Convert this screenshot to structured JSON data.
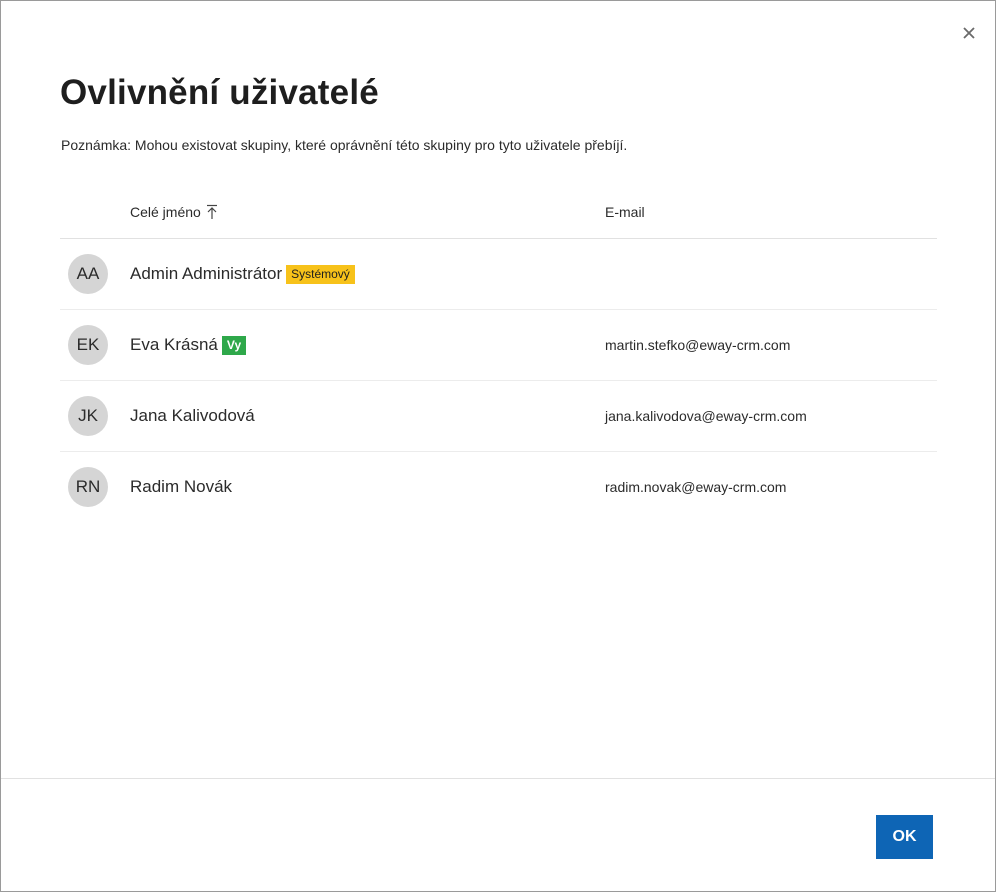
{
  "dialog": {
    "title": "Ovlivnění uživatelé",
    "note": "Poznámka: Mohou existovat skupiny, které oprávnění této skupiny pro tyto uživatele přebíjí.",
    "close_icon": "close-icon"
  },
  "table": {
    "columns": {
      "name": "Celé jméno",
      "email": "E-mail"
    },
    "sort_icon": "sort-ascending-icon",
    "rows": [
      {
        "initials": "AA",
        "name": "Admin Administrátor",
        "badge": "Systémový",
        "email": ""
      },
      {
        "initials": "EK",
        "name": "Eva Krásná",
        "badge": "Vy",
        "email": "martin.stefko@eway-crm.com"
      },
      {
        "initials": "JK",
        "name": "Jana Kalivodová",
        "badge": "",
        "email": "jana.kalivodova@eway-crm.com"
      },
      {
        "initials": "RN",
        "name": "Radim Novák",
        "badge": "",
        "email": "radim.novak@eway-crm.com"
      }
    ]
  },
  "footer": {
    "ok_label": "OK"
  },
  "colors": {
    "primary": "#0e65b5",
    "badge_system": "#f7c21a",
    "badge_you": "#2ea84a",
    "avatar_bg": "#d5d5d5"
  }
}
